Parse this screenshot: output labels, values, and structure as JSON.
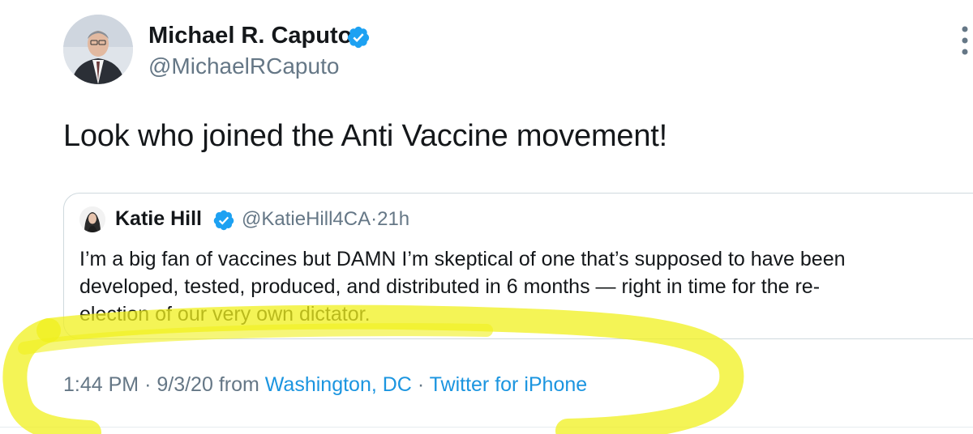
{
  "author": {
    "display_name": "Michael R. Caputo",
    "handle": "@MichaelRCaputo",
    "verified": true
  },
  "tweet": {
    "text": "Look who joined the Anti Vaccine movement!"
  },
  "quoted_tweet": {
    "display_name": "Katie Hill",
    "verified": true,
    "handle": "@KatieHill4CA",
    "separator": "·",
    "time_ago": "21h",
    "text_lines": [
      "I’m a big fan of vaccines but DAMN I’m skeptical of one that’s supposed to have been",
      "developed, tested, produced, and distributed in 6 months — right in time for the re-",
      "election of our very own dictator."
    ]
  },
  "meta": {
    "time": "1:44 PM",
    "separator": "·",
    "date": "9/3/20",
    "from_label": "from",
    "location": "Washington, DC",
    "source": "Twitter for iPhone"
  },
  "colors": {
    "verified": "#1da1f2",
    "link": "#1b95e0",
    "secondary_text": "#657786",
    "highlight": "#f0f01e"
  },
  "icons": {
    "verified": "verified-badge-icon",
    "more": "more-options-icon"
  }
}
